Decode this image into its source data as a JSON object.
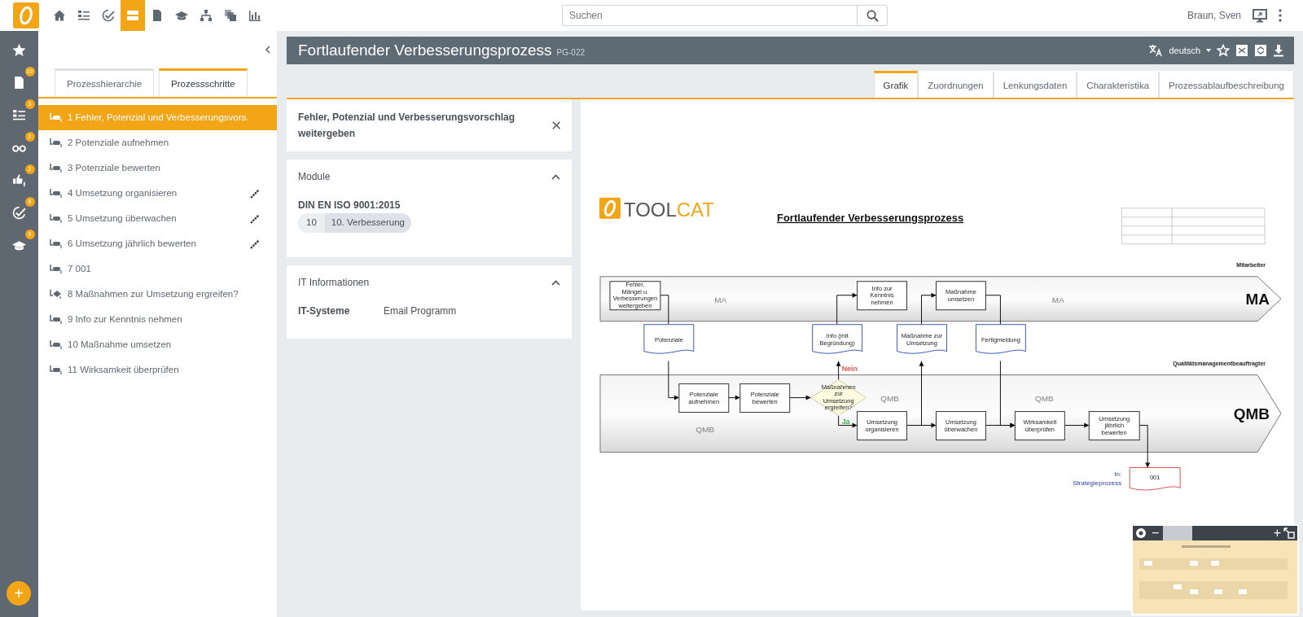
{
  "app_bar": {
    "nav_icons": [
      {
        "kind": "home",
        "selected": false
      },
      {
        "kind": "list",
        "selected": false
      },
      {
        "kind": "check",
        "selected": false
      },
      {
        "kind": "rows",
        "selected": true
      },
      {
        "kind": "doc",
        "selected": false
      },
      {
        "kind": "cap",
        "selected": false
      },
      {
        "kind": "tree",
        "selected": false
      },
      {
        "kind": "copies",
        "selected": false
      },
      {
        "kind": "chart",
        "selected": false
      }
    ],
    "search": {
      "placeholder": "Suchen"
    },
    "user": "Braun, Sven"
  },
  "rail": {
    "items": [
      {
        "kind": "star"
      },
      {
        "kind": "doc",
        "badge": "10"
      },
      {
        "kind": "list",
        "badge": "3"
      },
      {
        "kind": "glasses",
        "badge": "2"
      },
      {
        "kind": "thumbs",
        "badge": "2"
      },
      {
        "kind": "check",
        "badge": "8"
      },
      {
        "kind": "cap",
        "badge": "9"
      }
    ],
    "add_button": "+"
  },
  "sidebar": {
    "tabs": [
      {
        "label": "Prozesshierarchie",
        "selected": false
      },
      {
        "label": "Prozessschritte",
        "selected": true
      }
    ],
    "steps": [
      {
        "label": "1 Fehler, Potenzial und Verbesserungsvors.",
        "kind": "task",
        "selected": true,
        "linked": false
      },
      {
        "label": "2 Potenziale aufnehmen",
        "kind": "task",
        "selected": false,
        "linked": false
      },
      {
        "label": "3 Potenziale bewerten",
        "kind": "task",
        "selected": false,
        "linked": false
      },
      {
        "label": "4 Umsetzung organisieren",
        "kind": "task",
        "selected": false,
        "linked": true
      },
      {
        "label": "5 Umsetzung überwachen",
        "kind": "task",
        "selected": false,
        "linked": true
      },
      {
        "label": "6 Umsetzung jährlich bewerten",
        "kind": "task",
        "selected": false,
        "linked": true
      },
      {
        "label": "7 001",
        "kind": "task",
        "selected": false,
        "linked": false
      },
      {
        "label": "8 Maßnahmen zur Umsetzung ergreifen?",
        "kind": "decision",
        "selected": false,
        "linked": false
      },
      {
        "label": "9 Info zur Kenntnis nehmen",
        "kind": "task",
        "selected": false,
        "linked": false
      },
      {
        "label": "10 Maßnahme umsetzen",
        "kind": "task",
        "selected": false,
        "linked": false
      },
      {
        "label": "11 Wirksamkeit überprüfen",
        "kind": "task",
        "selected": false,
        "linked": false
      }
    ]
  },
  "process": {
    "title": "Fortlaufender Verbesserungsprozess",
    "code": "PG-022",
    "language": "deutsch"
  },
  "tabs": [
    {
      "label": "Grafik",
      "selected": true
    },
    {
      "label": "Zuordnungen",
      "selected": false
    },
    {
      "label": "Lenkungsdaten",
      "selected": false
    },
    {
      "label": "Charakteristika",
      "selected": false
    },
    {
      "label": "Prozessablaufbeschreibung",
      "selected": false
    }
  ],
  "detail_card": {
    "title": "Fehler, Potenzial und Verbesserungsvorschlag weitergeben"
  },
  "modules_card": {
    "title": "Module",
    "expanded": true,
    "standard": "DIN EN ISO 9001:2015",
    "chip": {
      "number": "10",
      "label": "10. Verbesserung"
    }
  },
  "it_card": {
    "title": "IT Informationen",
    "expanded": true,
    "rows": [
      {
        "label": "IT-Systeme",
        "value": "Email Programm"
      }
    ]
  },
  "graphic": {
    "logo": [
      "TOOL",
      "CAT"
    ],
    "title": "Fortlaufender Verbesserungsprozess",
    "lanes": [
      {
        "name": "Mitarbeiter",
        "code": "MA",
        "watermarks": [
          "MA",
          "MA"
        ]
      },
      {
        "name": "Qualitätsmanagementbeauftragter",
        "code": "QMB",
        "watermarks": [
          "QMB",
          "QMB",
          "QMB"
        ]
      }
    ],
    "nodes": [
      {
        "kind": "task",
        "label": "Fehler, Mängel u. Verbesserungen weitergeben"
      },
      {
        "kind": "task",
        "label": "Info zur Kenntnis nehmen"
      },
      {
        "kind": "task",
        "label": "Maßnahme umsetzen"
      },
      {
        "kind": "document",
        "label": "Potenziale"
      },
      {
        "kind": "document",
        "label": "Info (mit Begründung)"
      },
      {
        "kind": "document",
        "label": "Maßnahme zur Umsetzung"
      },
      {
        "kind": "document",
        "label": "Fertigmeldung"
      },
      {
        "kind": "task",
        "label": "Potenziale aufnehmen"
      },
      {
        "kind": "task",
        "label": "Potenziale bewerten"
      },
      {
        "kind": "decision",
        "label": "Maßnahmen zur Umsetzung ergreifen?"
      },
      {
        "kind": "task",
        "label": "Umsetzung organisieren"
      },
      {
        "kind": "task",
        "label": "Umsetzung überwachen"
      },
      {
        "kind": "task",
        "label": "Wirksamkeit überprüfen"
      },
      {
        "kind": "task",
        "label": "Umsetzung jährlich bewerten"
      },
      {
        "kind": "reference",
        "label": "001"
      }
    ],
    "decision_labels": [
      {
        "label": "Nein",
        "color": "#e05a5a"
      },
      {
        "label": "Ja",
        "color": "#3cb043"
      }
    ],
    "external_ref": [
      "In:",
      "Strategieprozess"
    ]
  },
  "minimap": {
    "zoom_out": "−",
    "zoom_in": "+"
  }
}
